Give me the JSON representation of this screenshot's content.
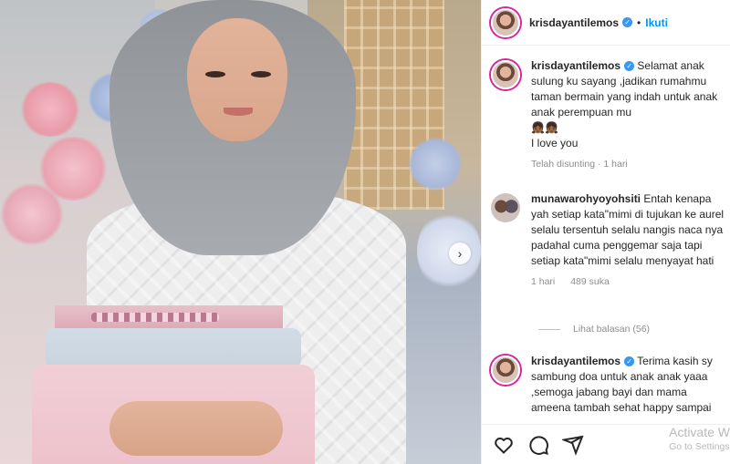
{
  "post_author": {
    "username": "krisdayantilemos",
    "follow_label": "Ikuti",
    "separator": "•"
  },
  "comments": [
    {
      "username": "krisdayantilemos",
      "verified": true,
      "text": "Selamat anak sulung ku sayang ,jadikan rumahmu taman bermain yang indah untuk anak anak perempuan mu",
      "emoji": "👧🏾👧🏾",
      "text2": "I love you",
      "meta": "Telah disunting · 1 hari"
    },
    {
      "username": "munawarohyoyohsiti",
      "verified": false,
      "text": "Entah kenapa yah setiap kata\"mimi di tujukan ke aurel selalu tersentuh selalu nangis naca nya padahal cuma penggemar saja tapi setiap kata\"mimi selalu menyayat hati",
      "time": "1 hari",
      "likes": "489 suka"
    },
    {
      "username": "krisdayantilemos",
      "verified": true,
      "text": "Terima kasih sy sambung doa untuk anak anak yaaa ,semoga jabang bayi dan mama ameena tambah sehat happy sampai"
    }
  ],
  "view_replies": "Lihat balasan (56)",
  "watermark": {
    "line1": "Activate W",
    "line2": "Go to Settings"
  },
  "icons": [
    "heart-icon",
    "comment-icon",
    "share-icon",
    "chevron-right-icon",
    "verified-icon"
  ],
  "colors": {
    "link": "#0095f6",
    "verified": "#3897f0",
    "muted": "#8e8e8e"
  }
}
